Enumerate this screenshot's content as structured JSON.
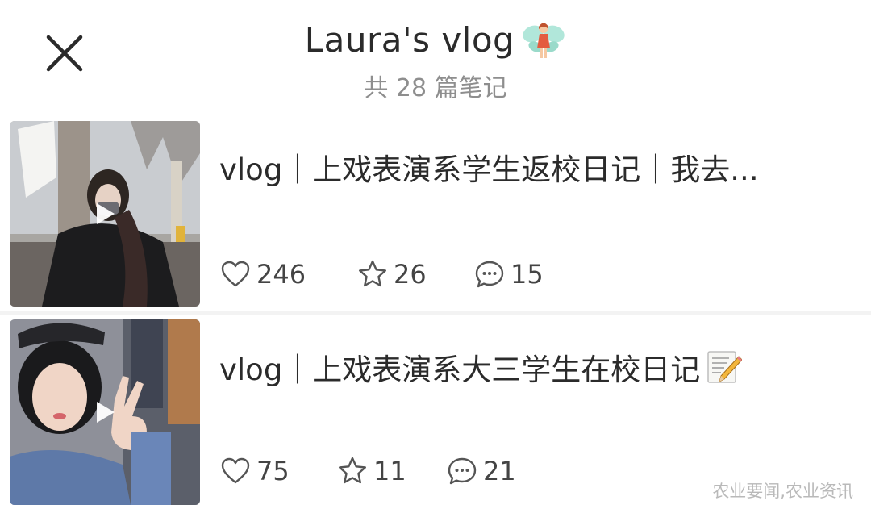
{
  "header": {
    "title": "Laura's vlog",
    "title_emoji_icon": "fairy-icon",
    "subtitle": "共 28 篇笔记",
    "close_icon": "close-icon"
  },
  "notes": [
    {
      "title": "vlog｜上戏表演系学生返校日记｜我去...",
      "thumbnail_icon": "video-thumbnail",
      "likes": "246",
      "favorites": "26",
      "comments": "15"
    },
    {
      "title": "vlog｜上戏表演系大三学生在校日记",
      "title_emoji_icon": "memo-icon",
      "thumbnail_icon": "video-thumbnail",
      "likes": "75",
      "favorites": "11",
      "comments": "21"
    }
  ],
  "watermark": "农业要闻,农业资讯",
  "colors": {
    "background": "#f3f3f3",
    "card": "#ffffff",
    "text": "#2b2b2b",
    "muted": "#8e8e8e"
  }
}
